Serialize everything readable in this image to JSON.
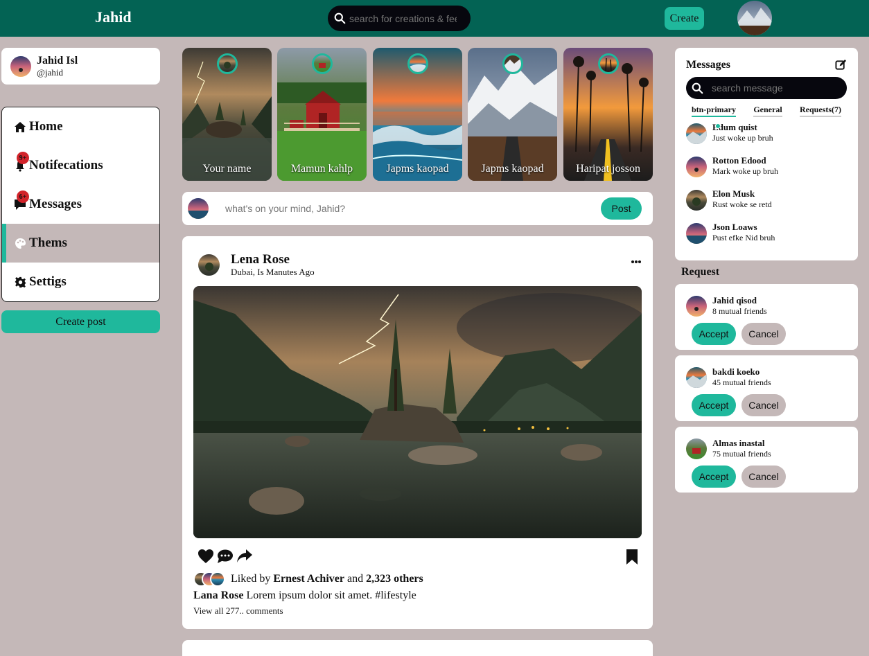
{
  "colors": {
    "primary": "#036354",
    "accent": "#1fb89c",
    "bg": "#c4b8b8",
    "dark": "#07070e",
    "badge": "#d1232a"
  },
  "navbar": {
    "logo": "Jahid",
    "search_placeholder": "search for creations & feed",
    "create_label": "Create"
  },
  "profile": {
    "name": "Jahid Isl",
    "handle": "@jahid"
  },
  "menu": [
    {
      "label": "Home",
      "icon": "home-icon"
    },
    {
      "label": "Notifecations",
      "icon": "bell-icon",
      "badge": "9+"
    },
    {
      "label": "Messages",
      "icon": "chat-icon",
      "badge": "6+"
    },
    {
      "label": "Thems",
      "icon": "palette-icon",
      "active": true
    },
    {
      "label": "Settigs",
      "icon": "gear-icon"
    }
  ],
  "create_post_label": "Create post",
  "stories": [
    {
      "name": "Your name"
    },
    {
      "name": "Mamun kahlp"
    },
    {
      "name": "Japms kaopad"
    },
    {
      "name": "Japms kaopad"
    },
    {
      "name": "Haripat josson"
    }
  ],
  "composer": {
    "placeholder": "what's on your mind, Jahid?",
    "post_label": "Post"
  },
  "post": {
    "author": "Lena Rose",
    "location": "Dubai, Is Manutes Ago",
    "liked_prefix": "Liked by",
    "liked_user": "Ernest Achiver",
    "liked_and": "and",
    "liked_others": "2,323 others",
    "caption_author": "Lana Rose",
    "caption_text": "Lorem ipsum dolor sit amet.",
    "caption_tag": "#lifestyle",
    "comments": "View all 277.. comments"
  },
  "messages": {
    "title": "Messages",
    "search_placeholder": "search message",
    "tabs": [
      "btn-primary",
      "General",
      "Requests(7)"
    ],
    "items": [
      {
        "name": "Edum quist",
        "text": "Just woke up bruh",
        "online": true
      },
      {
        "name": "Rotton Edood",
        "text": "Mark woke up bruh"
      },
      {
        "name": "Elon Musk",
        "text": "Rust woke se retd"
      },
      {
        "name": "Json Loaws",
        "text": "Pust efke Nid bruh"
      }
    ]
  },
  "requests": {
    "title": "Request",
    "accept": "Accept",
    "cancel": "Cancel",
    "items": [
      {
        "name": "Jahid qisod",
        "mutual": "8 mutual friends"
      },
      {
        "name": "bakdi koeko",
        "mutual": "45 mutual friends"
      },
      {
        "name": "Almas inastal",
        "mutual": "75 mutual friends"
      }
    ]
  }
}
